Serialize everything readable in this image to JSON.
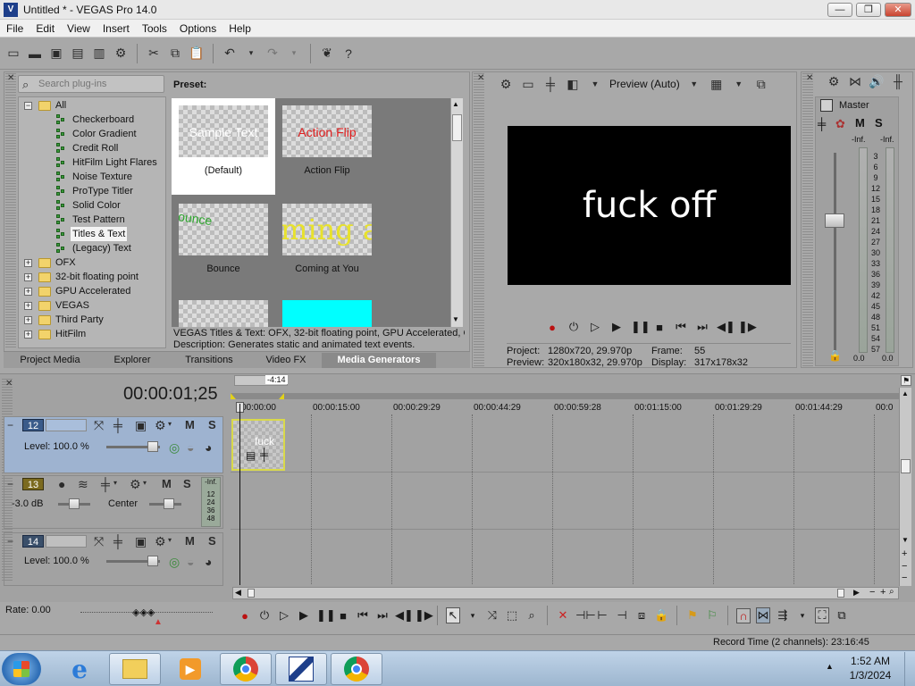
{
  "window": {
    "title": "Untitled * - VEGAS Pro 14.0",
    "min_label": "—",
    "max_label": "❐",
    "close_label": "✕"
  },
  "menu": [
    "File",
    "Edit",
    "View",
    "Insert",
    "Tools",
    "Options",
    "Help"
  ],
  "plugin_browser": {
    "search_placeholder": "Search plug-ins",
    "preset_label": "Preset:",
    "tree": [
      {
        "label": "All",
        "type": "folder",
        "expanded": true
      },
      {
        "label": "Checkerboard",
        "type": "plugin"
      },
      {
        "label": "Color Gradient",
        "type": "plugin"
      },
      {
        "label": "Credit Roll",
        "type": "plugin"
      },
      {
        "label": "HitFilm Light Flares",
        "type": "plugin"
      },
      {
        "label": "Noise Texture",
        "type": "plugin"
      },
      {
        "label": "ProType Titler",
        "type": "plugin"
      },
      {
        "label": "Solid Color",
        "type": "plugin"
      },
      {
        "label": "Test Pattern",
        "type": "plugin"
      },
      {
        "label": "Titles & Text",
        "type": "plugin",
        "selected": true
      },
      {
        "label": "(Legacy) Text",
        "type": "plugin"
      },
      {
        "label": "OFX",
        "type": "folder"
      },
      {
        "label": "32-bit floating point",
        "type": "folder"
      },
      {
        "label": "GPU Accelerated",
        "type": "folder"
      },
      {
        "label": "VEGAS",
        "type": "folder"
      },
      {
        "label": "Third Party",
        "type": "folder"
      },
      {
        "label": "HitFilm",
        "type": "folder"
      }
    ],
    "presets": [
      {
        "name": "(Default)",
        "thumb_text": "Sample Text",
        "selected": true
      },
      {
        "name": "Action Flip",
        "thumb_text": "Action Flip"
      },
      {
        "name": "Bounce",
        "thumb_text": "Bounce"
      },
      {
        "name": "Coming at You",
        "thumb_text": "ming at"
      }
    ],
    "description_line1": "VEGAS Titles & Text: OFX, 32-bit floating point, GPU Accelerated, Gr",
    "description_line2": "Description: Generates static and animated text events.",
    "tabs": [
      "Project Media",
      "Explorer",
      "Transitions",
      "Video FX",
      "Media Generators"
    ],
    "active_tab": "Media Generators"
  },
  "preview": {
    "mode": "Preview (Auto)",
    "screen_text": "fuck off",
    "project_label": "Project:",
    "project_value": "1280x720, 29.970p",
    "preview_label": "Preview:",
    "preview_value": "320x180x32, 29.970p",
    "frame_label": "Frame:",
    "frame_value": "55",
    "display_label": "Display:",
    "display_value": "317x178x32"
  },
  "mixer": {
    "master_label": "Master",
    "mute": "M",
    "solo": "S",
    "inf_left": "-Inf.",
    "inf_right": "-Inf.",
    "scale": [
      "3",
      "6",
      "9",
      "12",
      "15",
      "18",
      "21",
      "24",
      "27",
      "30",
      "33",
      "36",
      "39",
      "42",
      "45",
      "48",
      "51",
      "54",
      "57"
    ],
    "readout_left": "0.0",
    "readout_right": "0.0"
  },
  "timeline": {
    "timecode": "00:00:01;25",
    "region_length": "-4:14",
    "ruler": [
      "00:00:00",
      "00:00:15:00",
      "00:00:29:29",
      "00:00:44:29",
      "00:00:59:28",
      "00:01:15:00",
      "00:01:29:29",
      "00:01:44:29",
      "00:0"
    ],
    "clip_text": "fuck",
    "tracks": [
      {
        "number": "12",
        "level_label": "Level: 100.0 %",
        "mute": "M",
        "solo": "S"
      },
      {
        "number": "13",
        "vol_label": "-3.0 dB",
        "pan_label": "Center",
        "mute": "M",
        "solo": "S",
        "meter_top": "-Inf.",
        "meter_scale": [
          "12",
          "24",
          "36",
          "48"
        ]
      },
      {
        "number": "14",
        "level_label": "Level: 100.0 %",
        "mute": "M",
        "solo": "S"
      }
    ],
    "rate_label": "Rate: 0.00",
    "record_time": "Record Time (2 channels): 23:16:45"
  },
  "taskbar": {
    "time": "1:52 AM",
    "date": "1/3/2024"
  }
}
